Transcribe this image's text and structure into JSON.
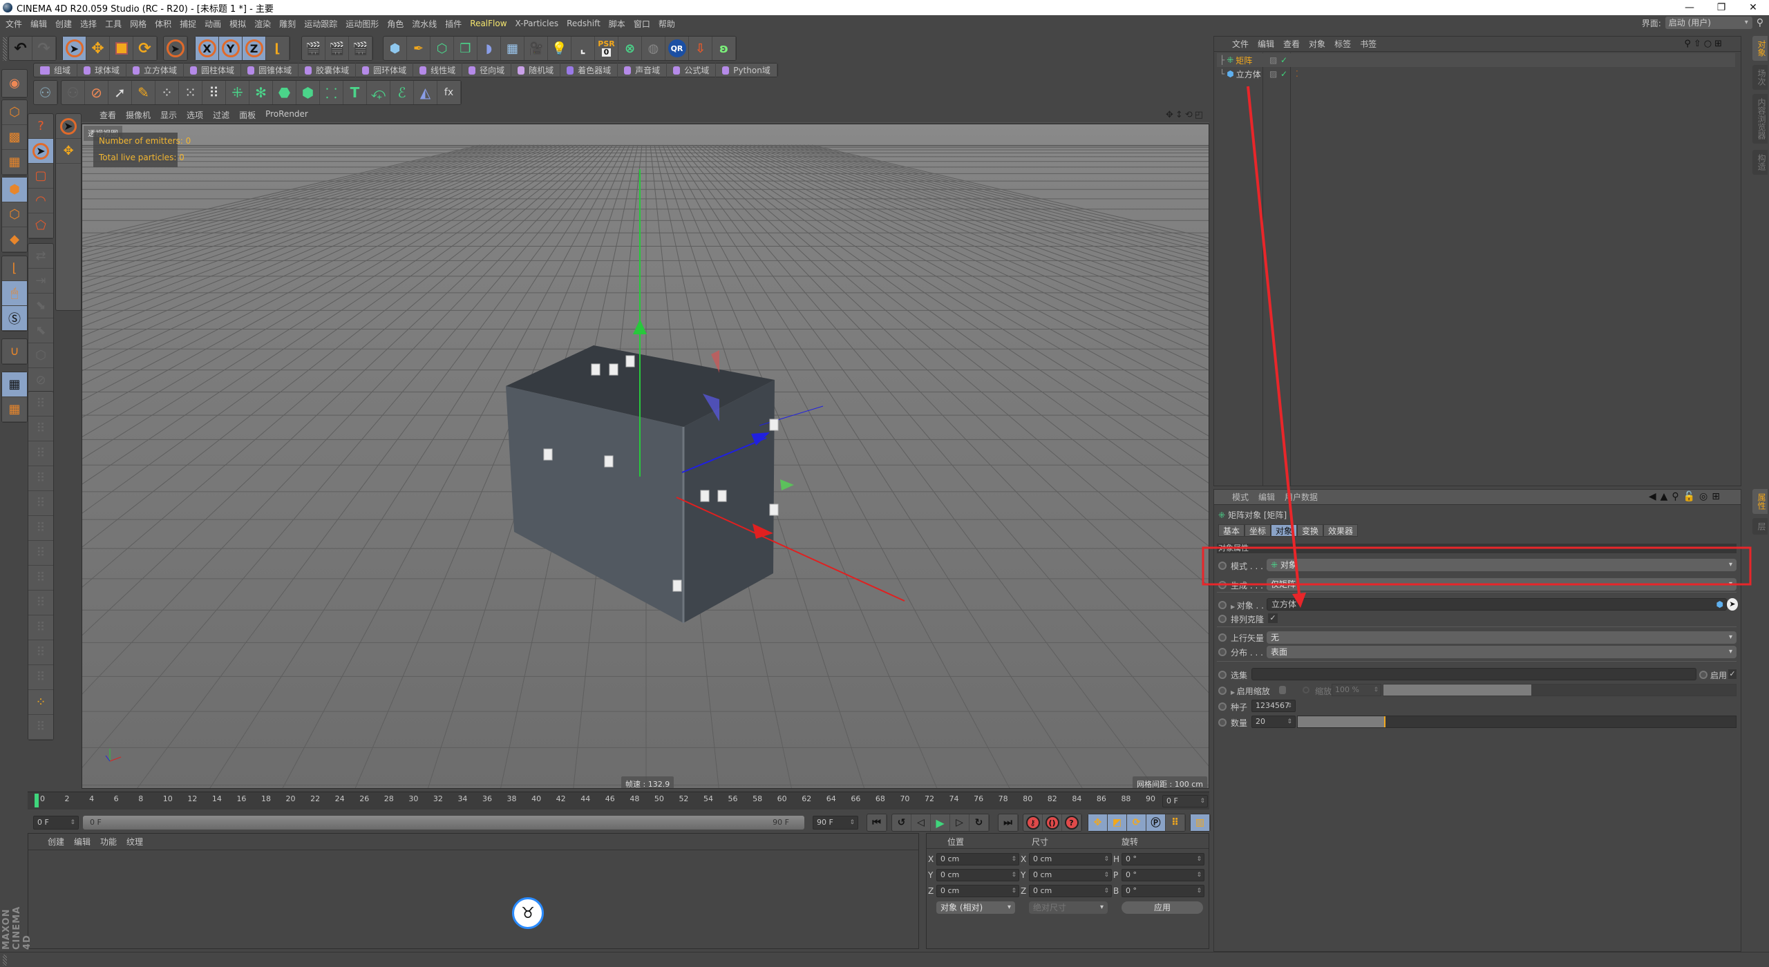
{
  "window": {
    "title": "CINEMA 4D R20.059 Studio (RC - R20) - [未标题 1 *] - 主要",
    "minimize": "—",
    "maximize": "❐",
    "close": "✕"
  },
  "menu": [
    "文件",
    "编辑",
    "创建",
    "选择",
    "工具",
    "网格",
    "体积",
    "捕捉",
    "动画",
    "模拟",
    "渲染",
    "雕刻",
    "运动跟踪",
    "运动图形",
    "角色",
    "流水线",
    "插件",
    "RealFlow",
    "X-Particles",
    "Redshift",
    "脚本",
    "窗口",
    "帮助"
  ],
  "menu_highlight": "RealFlow",
  "interface": {
    "label": "界面:",
    "value": "启动 (用户)"
  },
  "toolbar_main": {
    "undo": "↶",
    "redo": "↷",
    "axis_labels": [
      "X",
      "Y",
      "Z"
    ],
    "psr_label": "PSR",
    "psr_value": "0",
    "qr_label": "QR"
  },
  "fields_toolbar": [
    "组域",
    "球体域",
    "立方体域",
    "圆柱体域",
    "圆锥体域",
    "胶囊体域",
    "圆环体域",
    "线性域",
    "径向域",
    "随机域",
    "着色器域",
    "声音域",
    "公式域",
    "Python域"
  ],
  "viewport": {
    "menu": [
      "查看",
      "摄像机",
      "显示",
      "选项",
      "过滤",
      "面板",
      "ProRender"
    ],
    "view_name": "透视视图",
    "hud_emitters": "Number of emitters: 0",
    "hud_particles": "Total live particles: 0",
    "fps": "帧速 : 132.9",
    "grid_spacing": "网格间距 : 100 cm"
  },
  "timeline": {
    "ticks": [
      "0",
      "2",
      "4",
      "6",
      "8",
      "10",
      "12",
      "14",
      "16",
      "18",
      "20",
      "22",
      "24",
      "26",
      "28",
      "30",
      "32",
      "34",
      "36",
      "38",
      "40",
      "42",
      "44",
      "46",
      "48",
      "50",
      "52",
      "54",
      "56",
      "58",
      "60",
      "62",
      "64",
      "66",
      "68",
      "70",
      "72",
      "74",
      "76",
      "78",
      "80",
      "82",
      "84",
      "86",
      "88",
      "90"
    ],
    "current_frame": "0 F",
    "start_field": "0 F",
    "range_start": "0 F",
    "range_end": "90 F",
    "end_field": "90 F"
  },
  "material_manager": {
    "menu": [
      "创建",
      "编辑",
      "功能",
      "纹理"
    ]
  },
  "coordinates": {
    "headers": [
      "位置",
      "尺寸",
      "旋转"
    ],
    "position": [
      {
        "axis": "X",
        "value": "0 cm"
      },
      {
        "axis": "Y",
        "value": "0 cm"
      },
      {
        "axis": "Z",
        "value": "0 cm"
      }
    ],
    "size": [
      {
        "axis": "X",
        "value": "0 cm"
      },
      {
        "axis": "Y",
        "value": "0 cm"
      },
      {
        "axis": "Z",
        "value": "0 cm"
      }
    ],
    "rotation": [
      {
        "axis": "H",
        "value": "0 °"
      },
      {
        "axis": "P",
        "value": "0 °"
      },
      {
        "axis": "B",
        "value": "0 °"
      }
    ],
    "mode": "对象 (相对)",
    "size_mode": "绝对尺寸",
    "apply": "应用"
  },
  "object_manager": {
    "menu": [
      "文件",
      "编辑",
      "查看",
      "对象",
      "标签",
      "书签"
    ],
    "objects": [
      {
        "name": "矩阵",
        "selected": true
      },
      {
        "name": "立方体",
        "selected": false
      }
    ]
  },
  "side_tabs_top": [
    "对象",
    "场次",
    "内容浏览器",
    "构造"
  ],
  "side_tabs_bottom": [
    "属性",
    "层"
  ],
  "attribute_manager": {
    "menu": [
      "模式",
      "编辑",
      "用户数据"
    ],
    "object_title": "矩阵对象 [矩阵]",
    "tabs": [
      "基本",
      "坐标",
      "对象",
      "变换",
      "效果器"
    ],
    "active_tab": "对象",
    "section": "对象属性",
    "mode_label": "模式 . . . .",
    "mode_value": "对象",
    "generate_label": "生成 . . . .",
    "generate_value": "仅矩阵",
    "object_label": "对象 . . .",
    "object_value": "立方体",
    "clone_label": "排列克隆",
    "clone_checked": "✓",
    "up_vector_label": "上行矢量",
    "up_vector_value": "无",
    "distribution_label": "分布 . . . .",
    "distribution_value": "表面",
    "selection_label": "选集",
    "selection_value": "",
    "enable_label": "启用",
    "enable_checked": "✓",
    "scale_enable_label": "启用缩放",
    "scale_label": "缩放",
    "scale_value": "100 %",
    "scale_fraction": 0.42,
    "seed_label": "种子",
    "seed_value": "1234567",
    "count_label": "数量",
    "count_value": "20",
    "count_fraction": 0.2
  },
  "branding": "MAXON CINEMA 4D",
  "annotation_color": "#e8262a",
  "accent_color": "#f2a81d"
}
